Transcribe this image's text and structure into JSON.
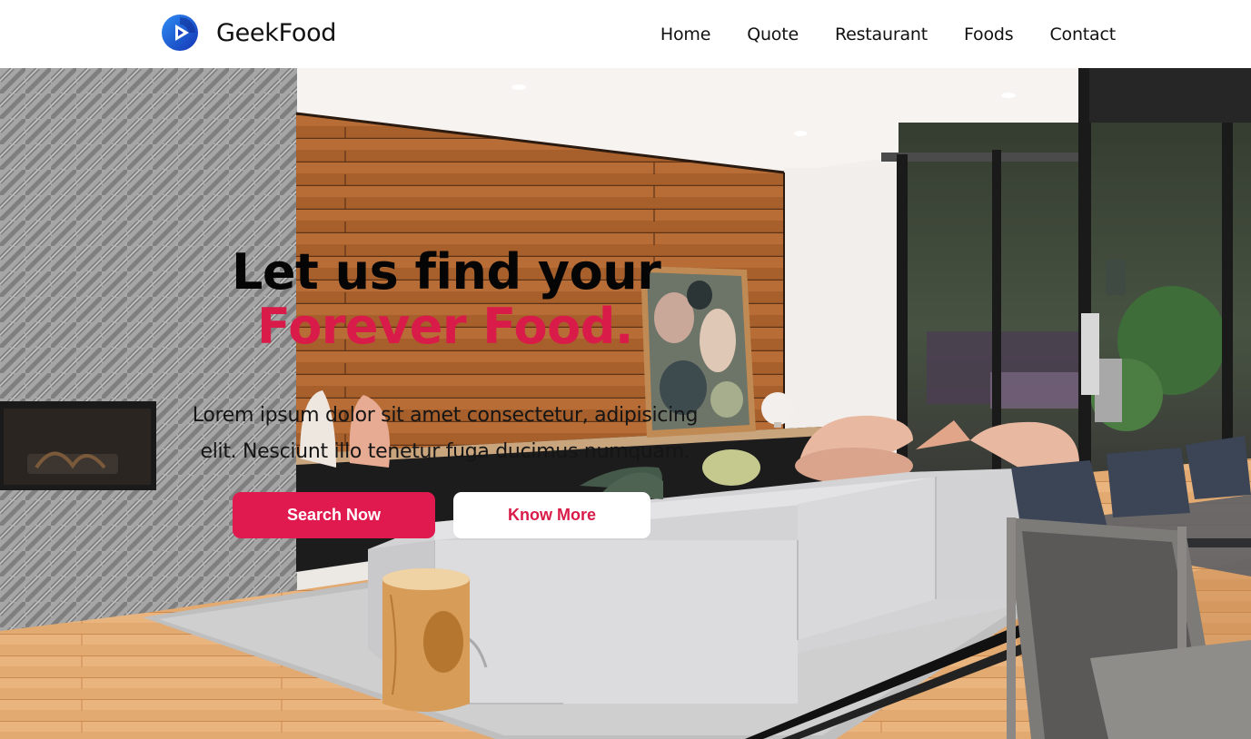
{
  "brand": {
    "name": "GeekFood",
    "logo_icon": "play-circle-icon",
    "logo_colors": [
      "#1e6be8",
      "#1339b8"
    ]
  },
  "nav": {
    "items": [
      {
        "label": "Home"
      },
      {
        "label": "Quote"
      },
      {
        "label": "Restaurant"
      },
      {
        "label": "Foods"
      },
      {
        "label": "Contact"
      }
    ]
  },
  "hero": {
    "headline_line1": "Let us find your",
    "headline_line2": "Forever Food.",
    "description": "Lorem ipsum dolor sit amet consectetur, adipisicing elit. Nesciunt illo tenetur fuga ducimus numquam.",
    "primary_button": "Search Now",
    "secondary_button": "Know More"
  },
  "colors": {
    "accent": "#e01a4f",
    "text": "#111111",
    "nav_background": "#ffffff"
  }
}
